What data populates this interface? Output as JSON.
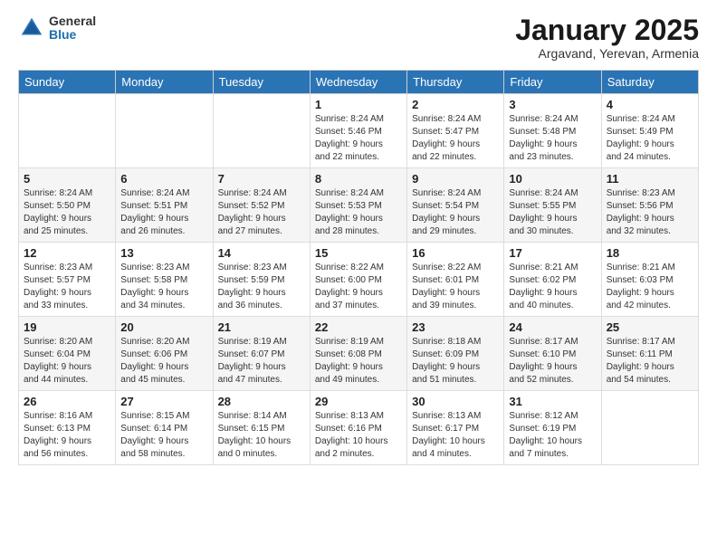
{
  "header": {
    "logo_general": "General",
    "logo_blue": "Blue",
    "month_title": "January 2025",
    "subtitle": "Argavand, Yerevan, Armenia"
  },
  "weekdays": [
    "Sunday",
    "Monday",
    "Tuesday",
    "Wednesday",
    "Thursday",
    "Friday",
    "Saturday"
  ],
  "weeks": [
    [
      {
        "day": "",
        "info": ""
      },
      {
        "day": "",
        "info": ""
      },
      {
        "day": "",
        "info": ""
      },
      {
        "day": "1",
        "info": "Sunrise: 8:24 AM\nSunset: 5:46 PM\nDaylight: 9 hours\nand 22 minutes."
      },
      {
        "day": "2",
        "info": "Sunrise: 8:24 AM\nSunset: 5:47 PM\nDaylight: 9 hours\nand 22 minutes."
      },
      {
        "day": "3",
        "info": "Sunrise: 8:24 AM\nSunset: 5:48 PM\nDaylight: 9 hours\nand 23 minutes."
      },
      {
        "day": "4",
        "info": "Sunrise: 8:24 AM\nSunset: 5:49 PM\nDaylight: 9 hours\nand 24 minutes."
      }
    ],
    [
      {
        "day": "5",
        "info": "Sunrise: 8:24 AM\nSunset: 5:50 PM\nDaylight: 9 hours\nand 25 minutes."
      },
      {
        "day": "6",
        "info": "Sunrise: 8:24 AM\nSunset: 5:51 PM\nDaylight: 9 hours\nand 26 minutes."
      },
      {
        "day": "7",
        "info": "Sunrise: 8:24 AM\nSunset: 5:52 PM\nDaylight: 9 hours\nand 27 minutes."
      },
      {
        "day": "8",
        "info": "Sunrise: 8:24 AM\nSunset: 5:53 PM\nDaylight: 9 hours\nand 28 minutes."
      },
      {
        "day": "9",
        "info": "Sunrise: 8:24 AM\nSunset: 5:54 PM\nDaylight: 9 hours\nand 29 minutes."
      },
      {
        "day": "10",
        "info": "Sunrise: 8:24 AM\nSunset: 5:55 PM\nDaylight: 9 hours\nand 30 minutes."
      },
      {
        "day": "11",
        "info": "Sunrise: 8:23 AM\nSunset: 5:56 PM\nDaylight: 9 hours\nand 32 minutes."
      }
    ],
    [
      {
        "day": "12",
        "info": "Sunrise: 8:23 AM\nSunset: 5:57 PM\nDaylight: 9 hours\nand 33 minutes."
      },
      {
        "day": "13",
        "info": "Sunrise: 8:23 AM\nSunset: 5:58 PM\nDaylight: 9 hours\nand 34 minutes."
      },
      {
        "day": "14",
        "info": "Sunrise: 8:23 AM\nSunset: 5:59 PM\nDaylight: 9 hours\nand 36 minutes."
      },
      {
        "day": "15",
        "info": "Sunrise: 8:22 AM\nSunset: 6:00 PM\nDaylight: 9 hours\nand 37 minutes."
      },
      {
        "day": "16",
        "info": "Sunrise: 8:22 AM\nSunset: 6:01 PM\nDaylight: 9 hours\nand 39 minutes."
      },
      {
        "day": "17",
        "info": "Sunrise: 8:21 AM\nSunset: 6:02 PM\nDaylight: 9 hours\nand 40 minutes."
      },
      {
        "day": "18",
        "info": "Sunrise: 8:21 AM\nSunset: 6:03 PM\nDaylight: 9 hours\nand 42 minutes."
      }
    ],
    [
      {
        "day": "19",
        "info": "Sunrise: 8:20 AM\nSunset: 6:04 PM\nDaylight: 9 hours\nand 44 minutes."
      },
      {
        "day": "20",
        "info": "Sunrise: 8:20 AM\nSunset: 6:06 PM\nDaylight: 9 hours\nand 45 minutes."
      },
      {
        "day": "21",
        "info": "Sunrise: 8:19 AM\nSunset: 6:07 PM\nDaylight: 9 hours\nand 47 minutes."
      },
      {
        "day": "22",
        "info": "Sunrise: 8:19 AM\nSunset: 6:08 PM\nDaylight: 9 hours\nand 49 minutes."
      },
      {
        "day": "23",
        "info": "Sunrise: 8:18 AM\nSunset: 6:09 PM\nDaylight: 9 hours\nand 51 minutes."
      },
      {
        "day": "24",
        "info": "Sunrise: 8:17 AM\nSunset: 6:10 PM\nDaylight: 9 hours\nand 52 minutes."
      },
      {
        "day": "25",
        "info": "Sunrise: 8:17 AM\nSunset: 6:11 PM\nDaylight: 9 hours\nand 54 minutes."
      }
    ],
    [
      {
        "day": "26",
        "info": "Sunrise: 8:16 AM\nSunset: 6:13 PM\nDaylight: 9 hours\nand 56 minutes."
      },
      {
        "day": "27",
        "info": "Sunrise: 8:15 AM\nSunset: 6:14 PM\nDaylight: 9 hours\nand 58 minutes."
      },
      {
        "day": "28",
        "info": "Sunrise: 8:14 AM\nSunset: 6:15 PM\nDaylight: 10 hours\nand 0 minutes."
      },
      {
        "day": "29",
        "info": "Sunrise: 8:13 AM\nSunset: 6:16 PM\nDaylight: 10 hours\nand 2 minutes."
      },
      {
        "day": "30",
        "info": "Sunrise: 8:13 AM\nSunset: 6:17 PM\nDaylight: 10 hours\nand 4 minutes."
      },
      {
        "day": "31",
        "info": "Sunrise: 8:12 AM\nSunset: 6:19 PM\nDaylight: 10 hours\nand 7 minutes."
      },
      {
        "day": "",
        "info": ""
      }
    ]
  ]
}
